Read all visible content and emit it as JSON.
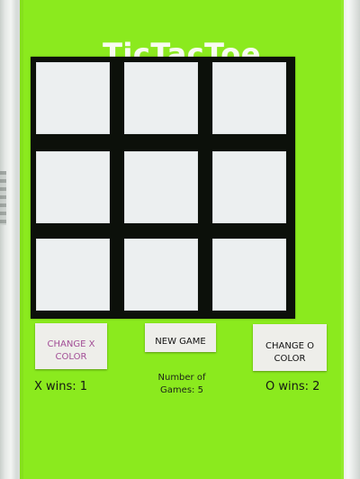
{
  "app": {
    "title": "TicTacToe"
  },
  "board": {
    "cells": [
      {
        "row": 1,
        "column": 1,
        "value": ""
      },
      {
        "row": 1,
        "column": 2,
        "value": ""
      },
      {
        "row": 1,
        "column": 3,
        "value": ""
      },
      {
        "row": 2,
        "column": 1,
        "value": ""
      },
      {
        "row": 2,
        "column": 2,
        "value": ""
      },
      {
        "row": 2,
        "column": 3,
        "value": ""
      },
      {
        "row": 3,
        "column": 1,
        "value": ""
      },
      {
        "row": 3,
        "column": 2,
        "value": ""
      },
      {
        "row": 3,
        "column": 3,
        "value": ""
      }
    ]
  },
  "controls": {
    "change_x_color_line1": "CHANGE X",
    "change_x_color_line2": "COLOR",
    "new_game": "NEW GAME",
    "change_o_color_line1": "CHANGE O",
    "change_o_color_line2": "COLOR"
  },
  "stats": {
    "number_of_label": "Number of",
    "games_text": "Games: 5",
    "x_wins": "X wins: 1",
    "o_wins": "O wins: 2"
  },
  "colors": {
    "screen_background": "#8bea1e",
    "board_background": "#0c100a",
    "cell_background": "#eceff0",
    "change_x_text": "#a24d96",
    "button_background": "#eeeeea"
  }
}
